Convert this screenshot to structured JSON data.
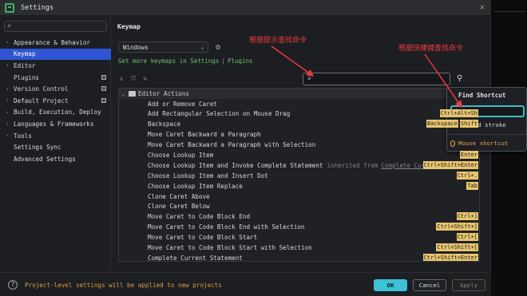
{
  "window": {
    "title": "Settings"
  },
  "sidebar": {
    "items": [
      {
        "label": "Appearance & Behavior",
        "chevron": true,
        "selected": false,
        "badge": false
      },
      {
        "label": "Keymap",
        "chevron": false,
        "selected": true,
        "badge": false
      },
      {
        "label": "Editor",
        "chevron": true,
        "selected": false,
        "badge": false
      },
      {
        "label": "Plugins",
        "chevron": false,
        "selected": false,
        "badge": true
      },
      {
        "label": "Version Control",
        "chevron": true,
        "selected": false,
        "badge": true
      },
      {
        "label": "Default Project",
        "chevron": true,
        "selected": false,
        "badge": true
      },
      {
        "label": "Build, Execution, Deploy",
        "chevron": true,
        "selected": false,
        "badge": false
      },
      {
        "label": "Languages & Frameworks",
        "chevron": true,
        "selected": false,
        "badge": false
      },
      {
        "label": "Tools",
        "chevron": true,
        "selected": false,
        "badge": false
      },
      {
        "label": "Settings Sync",
        "chevron": false,
        "selected": false,
        "badge": false
      },
      {
        "label": "Advanced Settings",
        "chevron": false,
        "selected": false,
        "badge": false
      }
    ]
  },
  "content": {
    "title": "Keymap",
    "keymap_select": "Windows",
    "plugins_link_left": "Get more keymaps in Settings",
    "plugins_link_pipe": "|",
    "plugins_link_right": "Plugins"
  },
  "tree": {
    "group": "Editor Actions",
    "rows": [
      {
        "name": "Add or Remove Caret",
        "inherited": "",
        "inherited_link": "",
        "keys": []
      },
      {
        "name": "Add Rectangular Selection on Mouse Drag",
        "inherited": "",
        "inherited_link": "",
        "keys": [
          "Ctrl+Alt+Sh"
        ]
      },
      {
        "name": "Backspace",
        "inherited": "",
        "inherited_link": "",
        "keys": [
          "Backspace",
          "Shift"
        ]
      },
      {
        "name": "Move Caret Backward a Paragraph",
        "inherited": "",
        "inherited_link": "",
        "keys": []
      },
      {
        "name": "Move Caret Backward a Paragraph with Selection",
        "inherited": "",
        "inherited_link": "",
        "keys": []
      },
      {
        "name": "Choose Lookup Item",
        "inherited": "",
        "inherited_link": "",
        "keys": [
          "Enter"
        ]
      },
      {
        "name": "Choose Lookup Item and Invoke Complete Statement",
        "inherited": "inherited from",
        "inherited_link": "Complete Curre",
        "keys": [
          "Ctrl+Shift+Enter"
        ]
      },
      {
        "name": "Choose Lookup Item and Insert Dot",
        "inherited": "",
        "inherited_link": "",
        "keys": [
          "Ctrl+."
        ]
      },
      {
        "name": "Choose Lookup Item Replace",
        "inherited": "",
        "inherited_link": "",
        "keys": [
          "Tab"
        ]
      },
      {
        "name": "Clone Caret Above",
        "inherited": "",
        "inherited_link": "",
        "keys": []
      },
      {
        "name": "Clone Caret Below",
        "inherited": "",
        "inherited_link": "",
        "keys": []
      },
      {
        "name": "Move Caret to Code Block End",
        "inherited": "",
        "inherited_link": "",
        "keys": [
          "Ctrl+]"
        ]
      },
      {
        "name": "Move Caret to Code Block End with Selection",
        "inherited": "",
        "inherited_link": "",
        "keys": [
          "Ctrl+Shift+]"
        ]
      },
      {
        "name": "Move Caret to Code Block Start",
        "inherited": "",
        "inherited_link": "",
        "keys": [
          "Ctrl+["
        ]
      },
      {
        "name": "Move Caret to Code Block Start with Selection",
        "inherited": "",
        "inherited_link": "",
        "keys": [
          "Ctrl+Shift+["
        ]
      },
      {
        "name": "Complete Current Statement",
        "inherited": "",
        "inherited_link": "",
        "keys": [
          "Ctrl+Shift+Enter"
        ]
      }
    ]
  },
  "popup": {
    "title": "Find Shortcut",
    "checkbox_label": "Second stroke",
    "mouse_label": "Mouse shortcut"
  },
  "annotations": {
    "search_by_name": "根据提示查找命令",
    "search_by_shortcut": "根据快捷键查找命令",
    "color": "#f03b3b"
  },
  "footer": {
    "help": "?",
    "message": "Project-level settings will be applied to new projects",
    "ok": "OK",
    "cancel": "Cancel",
    "apply": "Apply"
  },
  "icons": {
    "search": "search-icon",
    "gear": "gear-icon",
    "expand_all": "expand-all-icon",
    "collapse_all": "collapse-all-icon",
    "edit": "edit-icon",
    "find_shortcut": "find-shortcut-icon",
    "mouse": "mouse-icon"
  },
  "colors": {
    "accent": "#2f55d4",
    "ok_button": "#3cc1d6",
    "shortcut_key": "#e7c56e",
    "link": "#6fc06f",
    "warning_text": "#e09a44"
  }
}
